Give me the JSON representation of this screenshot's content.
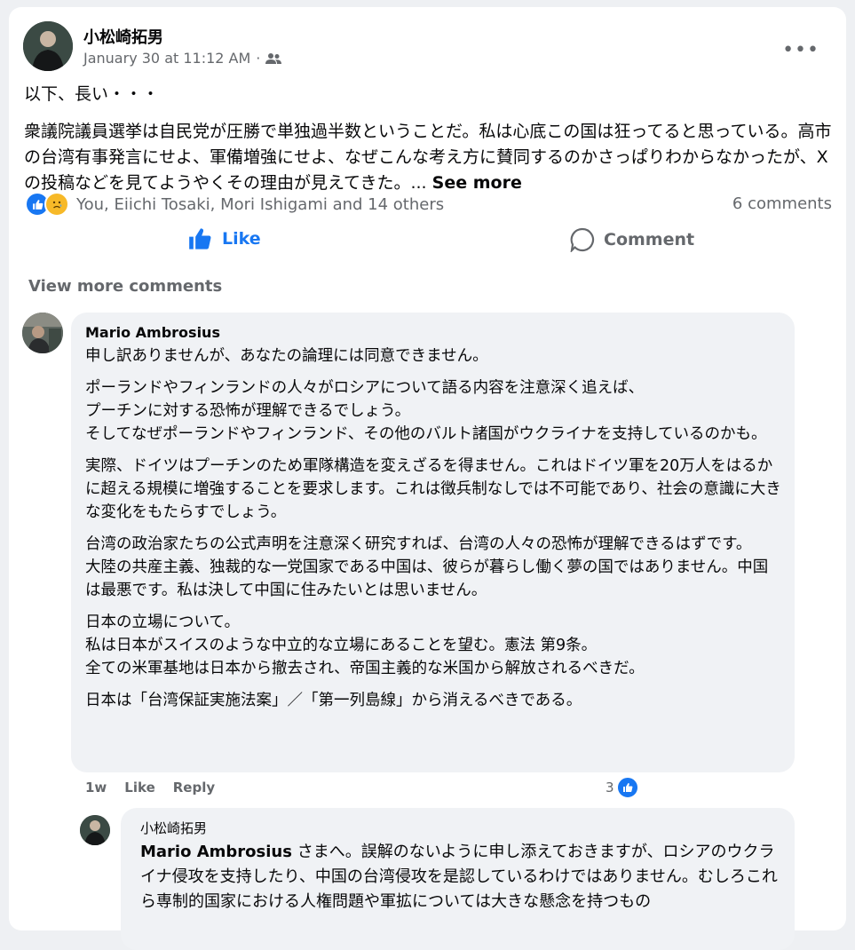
{
  "post": {
    "author": "小松崎拓男",
    "timestamp": "January 30 at 11:12 AM",
    "separator": "·",
    "audience_icon": "friends-icon",
    "more_icon": "•••",
    "paragraph1": "以下、長い・・・",
    "paragraph2": "衆議院議員選挙は自民党が圧勝で単独過半数ということだ。私は心底この国は狂ってると思っている。高市の台湾有事発言にせよ、軍備増強にせよ、なぜこんな考え方に賛同するのかさっぱりわからなかったが、Xの投稿などを見てようやくその理由が見えてきた。...",
    "see_more": "See more"
  },
  "reactions": {
    "summary": "You, Eiichi Tosaki, Mori Ishigami and 14 others",
    "comments": "6 comments",
    "like_color": "#1877f2"
  },
  "actions": {
    "like": "Like",
    "comment": "Comment"
  },
  "comments": {
    "view_more": "View more comments",
    "c1": {
      "author": "Mario Ambrosius",
      "paragraphs": [
        "申し訳ありませんが、あなたの論理には同意できません。",
        "ポーランドやフィンランドの人々がロシアについて語る内容を注意深く追えば、\nプーチンに対する恐怖が理解できるでしょう。\nそしてなぜポーランドやフィンランド、その他のバルト諸国がウクライナを支持しているのかも。",
        "実際、ドイツはプーチンのため軍隊構造を変えざるを得ません。これはドイツ軍を20万人をはるかに超える規模に増強することを要求します。これは徴兵制なしでは不可能であり、社会の意識に大きな変化をもたらすでしょう。",
        "台湾の政治家たちの公式声明を注意深く研究すれば、台湾の人々の恐怖が理解できるはずです。\n大陸の共産主義、独裁的な一党国家である中国は、彼らが暮らし働く夢の国ではありません。中国は最悪です。私は決して中国に住みたいとは思いません。",
        "日本の立場について。\n私は日本がスイスのような中立的な立場にあることを望む。憲法 第9条。\n全ての米軍基地は日本から撤去され、帝国主義的な米国から解放されるべきだ。",
        "日本は「台湾保証実施法案」／「第一列島線」から消えるべきである。"
      ],
      "time": "1w",
      "like": "Like",
      "reply": "Reply",
      "reaction_count": "3"
    },
    "c2": {
      "author": "小松崎拓男",
      "mention": "Mario Ambrosius",
      "text": " さまへ。誤解のないように申し添えておきますが、ロシアのウクライナ侵攻を支持したり、中国の台湾侵攻を是認しているわけではありません。むしろこれら専制的国家における人権問題や軍拡については大きな懸念を持つもの"
    }
  }
}
